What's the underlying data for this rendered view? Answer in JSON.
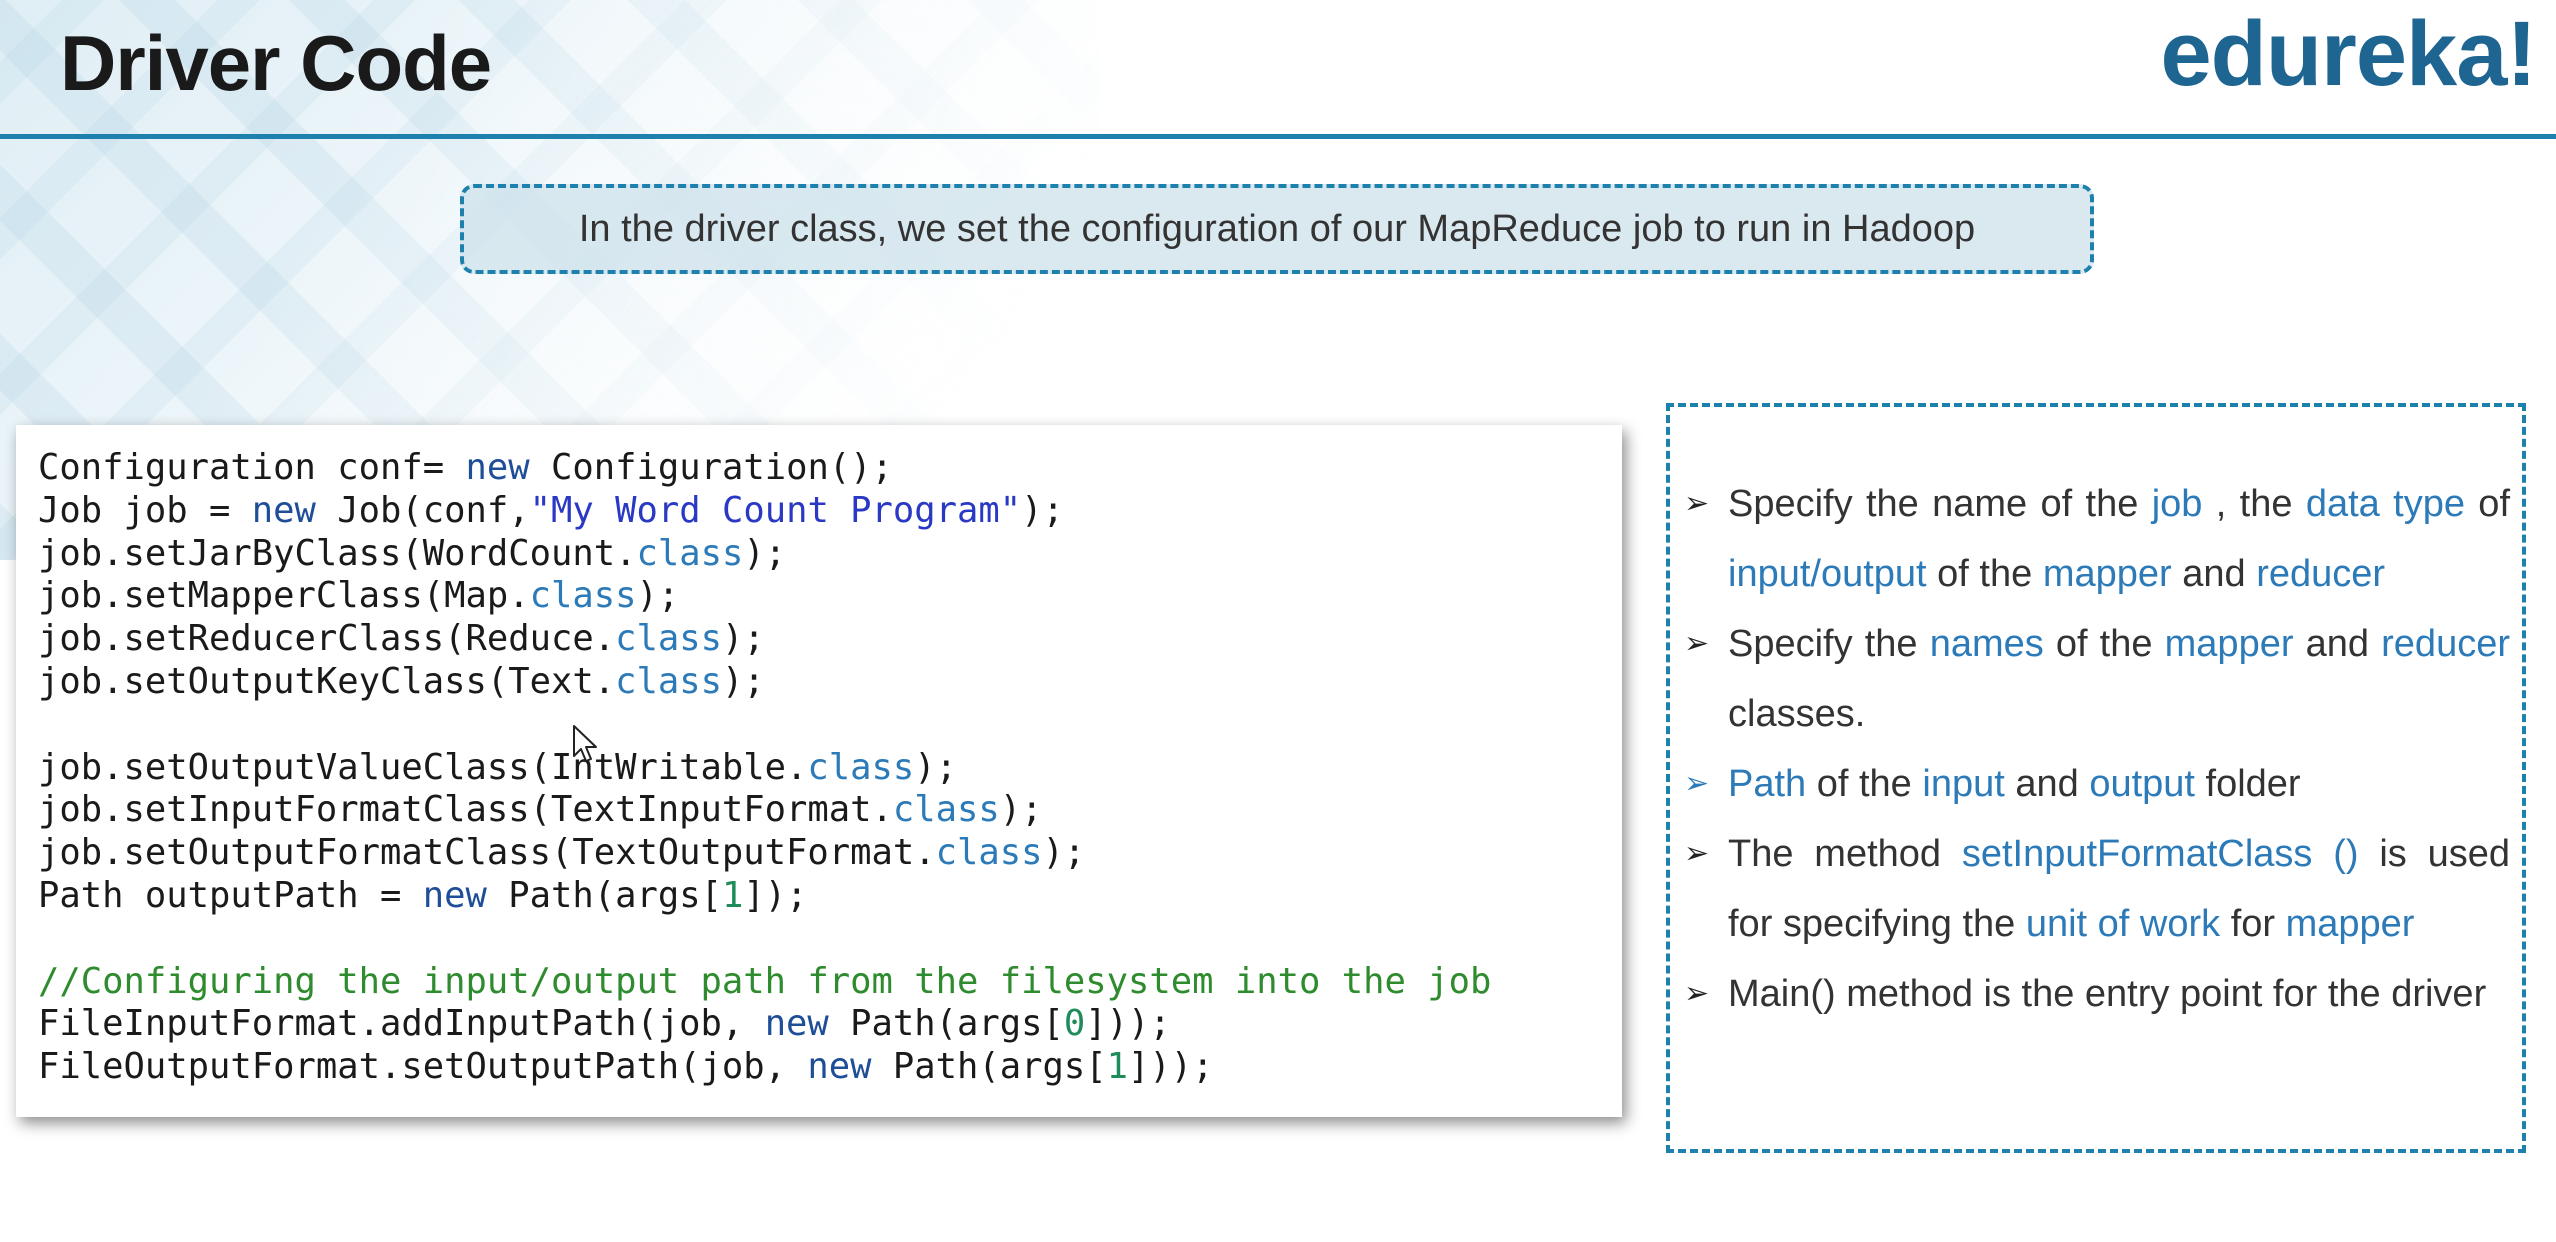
{
  "slide": {
    "title": "Driver Code",
    "logo": "edureka!",
    "intro": "In the driver class, we set the configuration of our MapReduce job to run in Hadoop"
  },
  "code": {
    "lines": [
      [
        {
          "t": "Configuration conf= "
        },
        {
          "t": "new",
          "c": "kw"
        },
        {
          "t": " Configuration();"
        }
      ],
      [
        {
          "t": "Job job = "
        },
        {
          "t": "new",
          "c": "kw"
        },
        {
          "t": " Job(conf,"
        },
        {
          "t": "\"My Word Count Program\"",
          "c": "str"
        },
        {
          "t": ");"
        }
      ],
      [
        {
          "t": "job.setJarByClass(WordCount."
        },
        {
          "t": "class",
          "c": "cls"
        },
        {
          "t": ");"
        }
      ],
      [
        {
          "t": "job.setMapperClass(Map."
        },
        {
          "t": "class",
          "c": "cls"
        },
        {
          "t": ");"
        }
      ],
      [
        {
          "t": "job.setReducerClass(Reduce."
        },
        {
          "t": "class",
          "c": "cls"
        },
        {
          "t": ");"
        }
      ],
      [
        {
          "t": "job.setOutputKeyClass(Text."
        },
        {
          "t": "class",
          "c": "cls"
        },
        {
          "t": ");"
        }
      ],
      [],
      [
        {
          "t": "job.setOutputValueClass(IntWritable."
        },
        {
          "t": "class",
          "c": "cls"
        },
        {
          "t": ");"
        }
      ],
      [
        {
          "t": "job.setInputFormatClass(TextInputFormat."
        },
        {
          "t": "class",
          "c": "cls"
        },
        {
          "t": ");"
        }
      ],
      [
        {
          "t": "job.setOutputFormatClass(TextOutputFormat."
        },
        {
          "t": "class",
          "c": "cls"
        },
        {
          "t": ");"
        }
      ],
      [
        {
          "t": "Path outputPath = "
        },
        {
          "t": "new",
          "c": "kw"
        },
        {
          "t": " Path(args["
        },
        {
          "t": "1",
          "c": "num"
        },
        {
          "t": "]);"
        }
      ],
      [],
      [
        {
          "t": "//Configuring the input/output path from the filesystem into the job",
          "c": "cmt"
        }
      ],
      [
        {
          "t": "FileInputFormat.addInputPath(job, "
        },
        {
          "t": "new",
          "c": "kw"
        },
        {
          "t": " Path(args["
        },
        {
          "t": "0",
          "c": "num"
        },
        {
          "t": "]));"
        }
      ],
      [
        {
          "t": "FileOutputFormat.setOutputPath(job, "
        },
        {
          "t": "new",
          "c": "kw"
        },
        {
          "t": " Path(args["
        },
        {
          "t": "1",
          "c": "num"
        },
        {
          "t": "]));"
        }
      ]
    ]
  },
  "bullets": [
    {
      "arrow_color": "dark",
      "parts": [
        {
          "t": "Specify the name of the "
        },
        {
          "t": "job",
          "h": true
        },
        {
          "t": " , the "
        },
        {
          "t": "data type",
          "h": true
        },
        {
          "t": " of "
        },
        {
          "t": "input/output",
          "h": true
        },
        {
          "t": " of the "
        },
        {
          "t": "mapper",
          "h": true
        },
        {
          "t": " and "
        },
        {
          "t": "reducer",
          "h": true
        }
      ]
    },
    {
      "arrow_color": "dark",
      "parts": [
        {
          "t": "Specify the "
        },
        {
          "t": "names",
          "h": true
        },
        {
          "t": " of the "
        },
        {
          "t": "mapper",
          "h": true
        },
        {
          "t": " and "
        },
        {
          "t": "reducer",
          "h": true
        },
        {
          "t": " classes."
        }
      ]
    },
    {
      "arrow_color": "blue",
      "parts": [
        {
          "t": "Path",
          "h": true
        },
        {
          "t": " of the "
        },
        {
          "t": "input",
          "h": true
        },
        {
          "t": " and "
        },
        {
          "t": "output",
          "h": true
        },
        {
          "t": " folder"
        }
      ]
    },
    {
      "arrow_color": "dark",
      "parts": [
        {
          "t": "The method "
        },
        {
          "t": "setInputFormatClass ()",
          "h": true
        },
        {
          "t": " is used for specifying the "
        },
        {
          "t": "unit of work",
          "h": true
        },
        {
          "t": " for "
        },
        {
          "t": "mapper",
          "h": true
        }
      ]
    },
    {
      "arrow_color": "dark",
      "parts": [
        {
          "t": "Main() method is the entry point for the driver"
        }
      ]
    }
  ],
  "icons": {
    "bullet_arrow": "➢",
    "cursor": "mouse-pointer-icon"
  },
  "colors": {
    "accent": "#1d80ad",
    "logo": "#1e6592",
    "highlight": "#2c7ab8",
    "keyword": "#1f4e98",
    "string": "#2a39c4",
    "number": "#1f8a5a",
    "comment": "#2e8b2e"
  }
}
